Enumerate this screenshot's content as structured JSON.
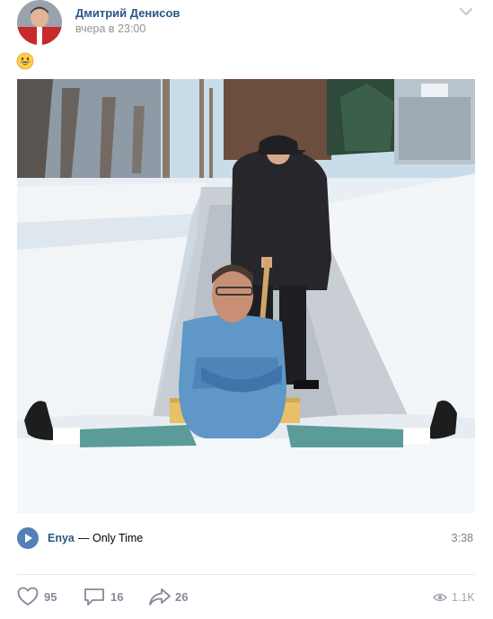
{
  "post": {
    "author": "Дмитрий Денисов",
    "time": "вчера в 23:00",
    "emoji": "grinning-face-emoji"
  },
  "audio": {
    "artist": "Enya",
    "separator": "—",
    "title": "Only Time",
    "duration": "3:38"
  },
  "actions": {
    "likes": "95",
    "comments": "16",
    "shares": "26",
    "views": "1.1K"
  },
  "colors": {
    "link": "#2a5885",
    "accent": "#5181b8",
    "muted": "#828a99"
  }
}
